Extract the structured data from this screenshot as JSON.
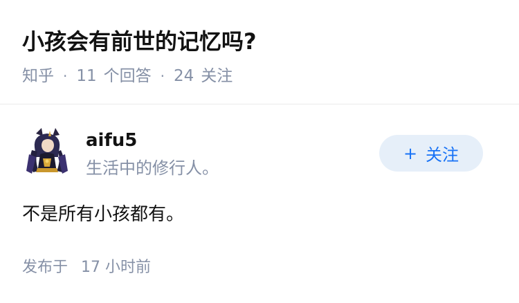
{
  "question": {
    "title": "小孩会有前世的记忆吗?",
    "source": "知乎",
    "answer_count": "11",
    "answer_label": "个回答",
    "follow_count": "24",
    "follow_label": "关注"
  },
  "answer": {
    "author": {
      "name": "aifu5",
      "bio": "生活中的修行人。",
      "avatar_icon": "anime-character-avatar"
    },
    "follow_button": {
      "icon": "+",
      "label": "关注"
    },
    "content": "不是所有小孩都有。",
    "published_label": "发布于",
    "published_time": "17 小时前"
  },
  "colors": {
    "primary_text": "#121212",
    "secondary_text": "#8590a6",
    "follow_button_bg": "#e6eff9",
    "follow_button_text": "#1772f6",
    "divider": "#ebebeb"
  }
}
